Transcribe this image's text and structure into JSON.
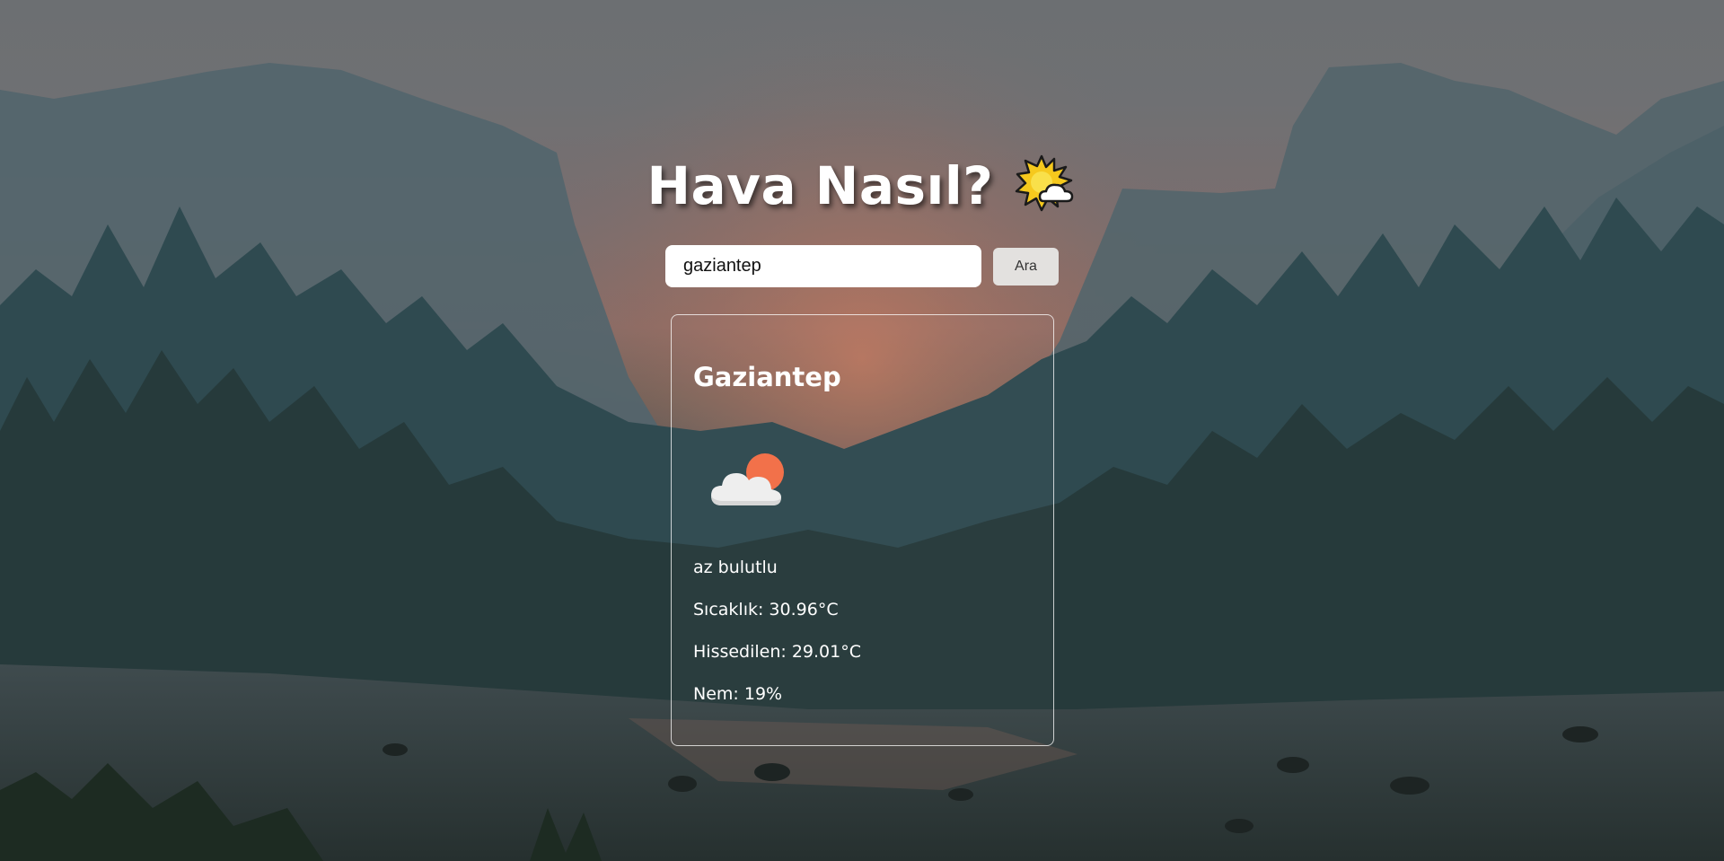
{
  "header": {
    "title": "Hava Nasıl?",
    "title_icon": "sun-behind-cloud-icon"
  },
  "search": {
    "value": "gaziantep",
    "placeholder": "",
    "button_label": "Ara"
  },
  "weather": {
    "city": "Gaziantep",
    "icon": "few-clouds-icon",
    "description": "az bulutlu",
    "temperature": "Sıcaklık: 30.96°C",
    "feels_like": "Hissedilen: 29.01°C",
    "humidity": "Nem: 19%"
  },
  "colors": {
    "card_border": "#ffffff",
    "button_bg": "#e3e1df",
    "sun_orange": "#f2714a"
  }
}
